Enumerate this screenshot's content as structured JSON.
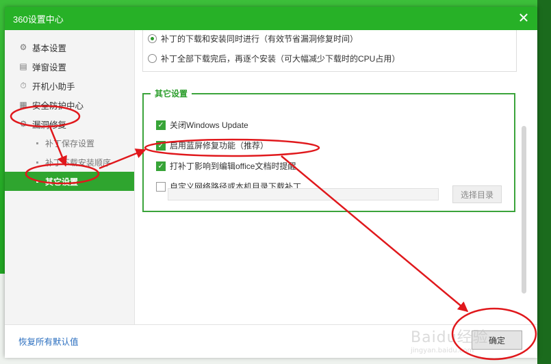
{
  "window": {
    "title": "360设置中心"
  },
  "sidebar": {
    "items": [
      {
        "label": "基本设置",
        "icon": "gear-icon"
      },
      {
        "label": "弹窗设置",
        "icon": "window-icon"
      },
      {
        "label": "开机小助手",
        "icon": "stopwatch-icon"
      },
      {
        "label": "安全防护中心",
        "icon": "shield-grid-icon"
      },
      {
        "label": "漏洞修复",
        "icon": "gear-icon"
      }
    ],
    "subitems": [
      {
        "label": "补丁保存设置"
      },
      {
        "label": "补丁下载安装顺序"
      },
      {
        "label": "其它设置"
      }
    ]
  },
  "main": {
    "radios": [
      {
        "label": "补丁的下载和安装同时进行（有效节省漏洞修复时间）",
        "checked": true
      },
      {
        "label": "补丁全部下载完后，再逐个安装（可大幅减少下载时的CPU占用）",
        "checked": false
      }
    ],
    "group_title": "其它设置",
    "checkboxes": [
      {
        "label": "关闭Windows Update",
        "checked": true
      },
      {
        "label": "启用蓝屏修复功能（推荐）",
        "checked": true
      },
      {
        "label": "打补丁影响到编辑office文档时提醒",
        "checked": true
      },
      {
        "label": "自定义网络路径或本机目录下载补丁",
        "checked": false
      }
    ],
    "path_value": "",
    "browse_label": "选择目录"
  },
  "footer": {
    "restore_label": "恢复所有默认值",
    "ok_label": "确定"
  },
  "watermark": {
    "text": "Baidu经验",
    "sub": "jingyan.baidu.com"
  },
  "colors": {
    "accent": "#27b127",
    "annotation": "#e0181c",
    "link": "#2a6ebf"
  }
}
